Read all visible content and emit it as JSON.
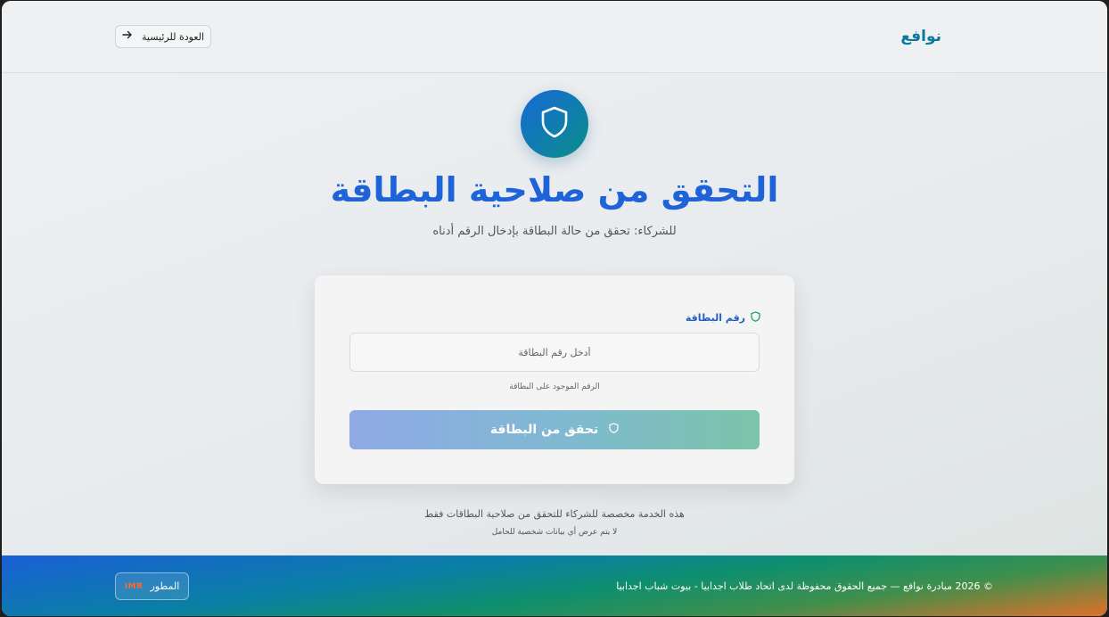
{
  "header": {
    "brand": "نوافع",
    "back_label": "العودة للرئيسية",
    "back_icon": "arrow-right-icon"
  },
  "hero": {
    "icon": "shield-icon",
    "title": "التحقق من صلاحية البطاقة",
    "subtitle": "للشركاء: تحقق من حالة البطاقة بإدخال الرقم أدناه"
  },
  "form": {
    "field_label": "رقم البطاقة",
    "field_icon": "shield-icon",
    "input_value": "",
    "input_placeholder": "أدخل رقم البطاقة",
    "hint": "الرقم الموجود على البطاقة",
    "submit_label": "تحقق من البطاقة",
    "submit_icon": "shield-icon"
  },
  "notes": {
    "line1": "هذه الخدمة مخصصة للشركاء للتحقق من صلاحية البطاقات فقط",
    "line2": "لا يتم عرض أي بيانات شخصية للحامل"
  },
  "footer": {
    "copyright": "© 2026 مبادرة نوافع — جميع الحقوق محفوظة لدى اتحاد طلاب اجدابيا - بيوت شباب اجدابيا",
    "developer_label": "المطور",
    "developer_logo": "IMR"
  },
  "colors": {
    "accent": "#1f63d9",
    "brand": "#0b7a9a",
    "teal": "#0a8f8a"
  }
}
